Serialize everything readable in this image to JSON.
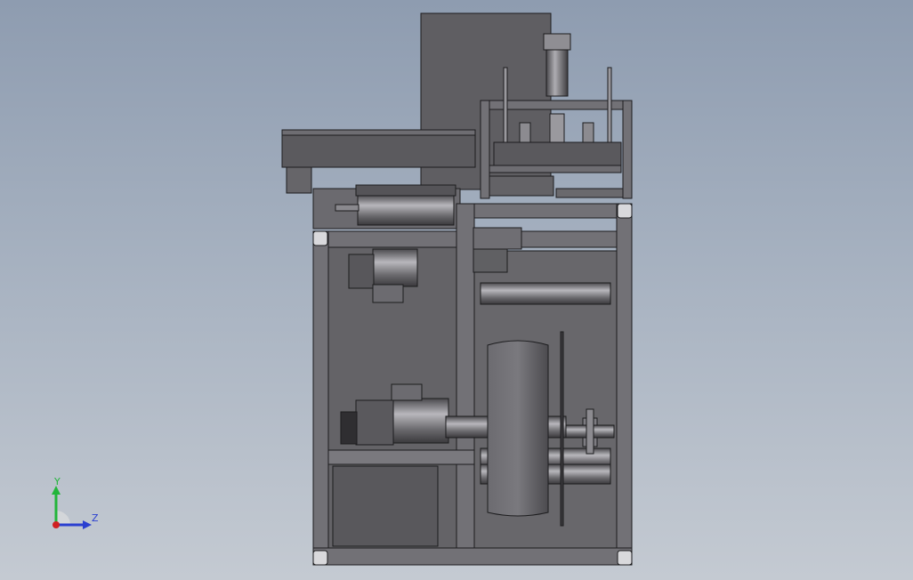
{
  "viewport": {
    "background_top": "#8e9cb0",
    "background_bottom": "#c4cad2"
  },
  "triad": {
    "y_label": "Y",
    "z_label": "Z",
    "y_color": "#22b53a",
    "z_color": "#2a3fd0",
    "x_color": "#d02020"
  },
  "model": {
    "body_color": "#5f5e62",
    "frame_color": "#727176",
    "edge_color": "#1c1c1e",
    "highlight_color": "#a9a8ad"
  }
}
